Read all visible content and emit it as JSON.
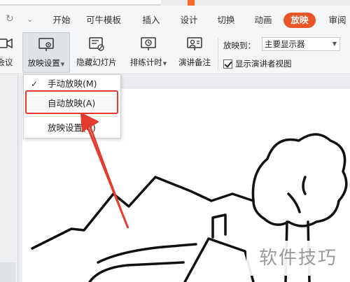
{
  "tabs": [
    "开始",
    "可牛模板",
    "插入",
    "设计",
    "切换",
    "动画",
    "放映",
    "审阅"
  ],
  "active_tab": "放映",
  "ribbon": {
    "left_cut_label": "会议",
    "slideshow_settings_label": "放映设置",
    "hide_slide_label": "隐藏幻灯片",
    "rehearse_timing_label": "排练计时",
    "presenter_notes_label": "演讲备注",
    "show_on_label": "放映到：",
    "show_on_value": "主要显示器",
    "presenter_view_label": "显示演讲者视图",
    "presenter_view_checked": true
  },
  "dropdown": {
    "manual": "手动放映(M)",
    "auto": "自动放映(A)",
    "settings": "放映设置(U)"
  },
  "watermark": "软件技巧",
  "colors": {
    "accent": "#e8562a",
    "highlight_border": "#e33b2e"
  }
}
